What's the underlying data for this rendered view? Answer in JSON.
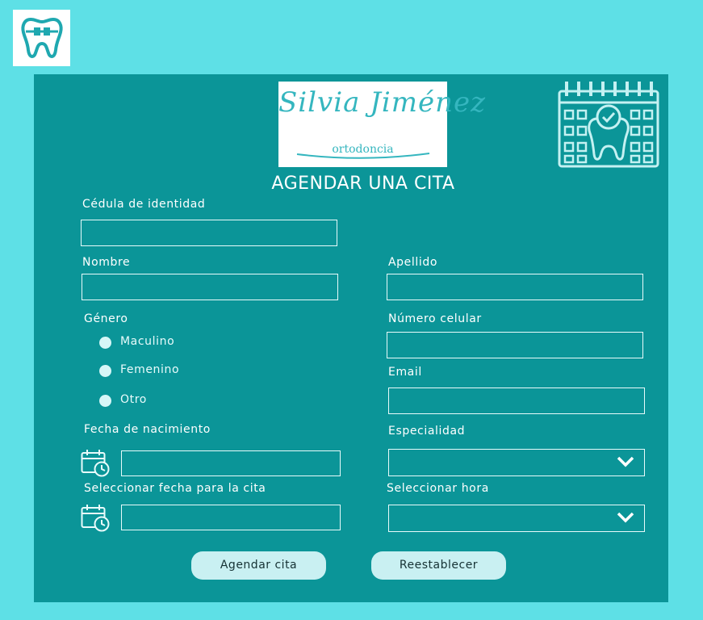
{
  "header": {
    "logo_icon": "tooth-braces-icon",
    "brand_name": "Silvia Jiménez",
    "brand_subtitle": "ortodoncia",
    "calendar_icon": "calendar-tooth-check-icon"
  },
  "form": {
    "title": "AGENDAR UNA CITA",
    "cedula": {
      "label": "Cédula de identidad",
      "value": ""
    },
    "nombre": {
      "label": "Nombre",
      "value": ""
    },
    "apellido": {
      "label": "Apellido",
      "value": ""
    },
    "genero": {
      "label": "Género",
      "options": [
        "Maculino",
        "Femenino",
        "Otro"
      ]
    },
    "celular": {
      "label": "Número celular",
      "value": ""
    },
    "email": {
      "label": "Email",
      "value": ""
    },
    "nacimiento": {
      "label": "Fecha de nacimiento",
      "value": ""
    },
    "especialidad": {
      "label": "Especialidad",
      "value": ""
    },
    "fecha_cita": {
      "label": "Seleccionar fecha para la cita",
      "value": ""
    },
    "hora": {
      "label": "Seleccionar hora",
      "value": ""
    }
  },
  "buttons": {
    "submit_label": "Agendar cita",
    "reset_label": "Reestablecer"
  },
  "colors": {
    "background": "#5ee0e6",
    "panel": "#0b9598",
    "button": "#c9f0f2",
    "brand": "#35b6bf"
  }
}
